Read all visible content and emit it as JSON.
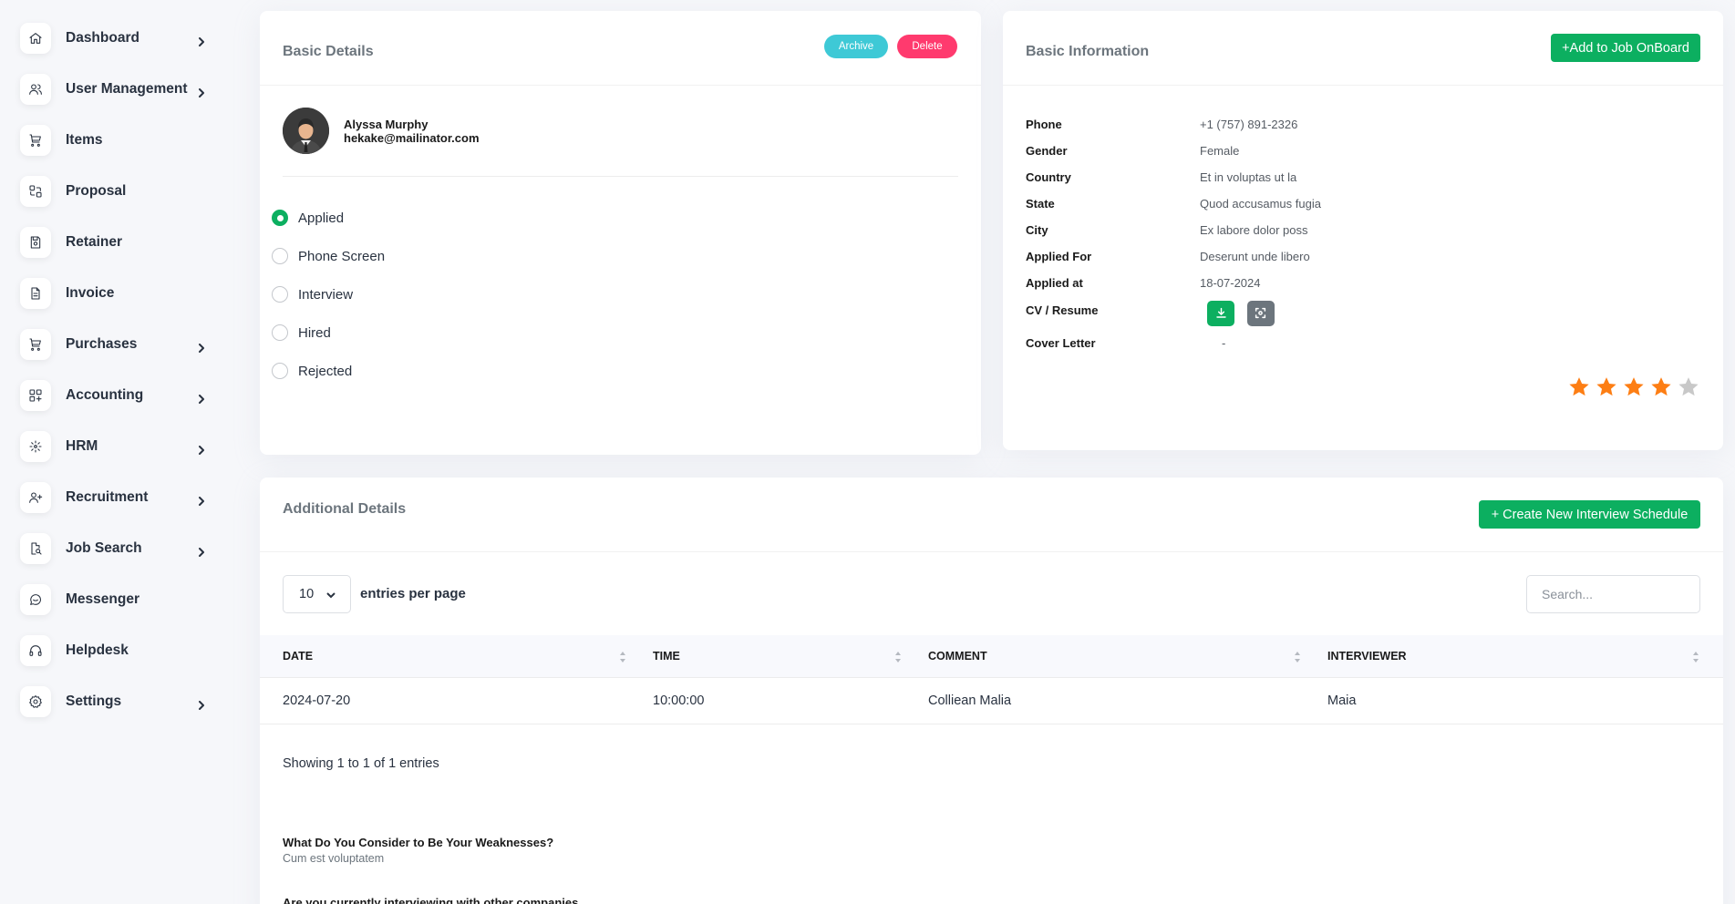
{
  "sidebar": {
    "items": [
      {
        "label": "Dashboard",
        "icon": "home-icon",
        "chevron": true
      },
      {
        "label": "User Management",
        "icon": "users-icon",
        "chevron": true
      },
      {
        "label": "Items",
        "icon": "cart-icon",
        "chevron": false
      },
      {
        "label": "Proposal",
        "icon": "exchange-icon",
        "chevron": false
      },
      {
        "label": "Retainer",
        "icon": "save-icon",
        "chevron": false
      },
      {
        "label": "Invoice",
        "icon": "file-invoice-icon",
        "chevron": false
      },
      {
        "label": "Purchases",
        "icon": "shopping-cart-icon",
        "chevron": true
      },
      {
        "label": "Accounting",
        "icon": "layout-grid-icon",
        "chevron": true
      },
      {
        "label": "HRM",
        "icon": "hrm-icon",
        "chevron": true
      },
      {
        "label": "Recruitment",
        "icon": "user-plus-icon",
        "chevron": true
      },
      {
        "label": "Job Search",
        "icon": "file-search-icon",
        "chevron": true
      },
      {
        "label": "Messenger",
        "icon": "message-icon",
        "chevron": false
      },
      {
        "label": "Helpdesk",
        "icon": "headphones-icon",
        "chevron": false
      },
      {
        "label": "Settings",
        "icon": "gear-icon",
        "chevron": true
      }
    ]
  },
  "basic_details": {
    "title": "Basic Details",
    "archive_label": "Archive",
    "delete_label": "Delete",
    "name": "Alyssa Murphy",
    "email": "hekake@mailinator.com",
    "statuses": [
      {
        "label": "Applied",
        "checked": true
      },
      {
        "label": "Phone Screen",
        "checked": false
      },
      {
        "label": "Interview",
        "checked": false
      },
      {
        "label": "Hired",
        "checked": false
      },
      {
        "label": "Rejected",
        "checked": false
      }
    ]
  },
  "basic_information": {
    "title": "Basic Information",
    "add_onboard_label": "+Add to Job OnBoard",
    "rows": {
      "phone": {
        "key": "Phone",
        "value": "+1 (757) 891-2326"
      },
      "gender": {
        "key": "Gender",
        "value": "Female"
      },
      "country": {
        "key": "Country",
        "value": "Et in voluptas ut la"
      },
      "state": {
        "key": "State",
        "value": "Quod accusamus fugia"
      },
      "city": {
        "key": "City",
        "value": "Ex labore dolor poss"
      },
      "applied_for": {
        "key": "Applied For",
        "value": "Deserunt unde libero"
      },
      "applied_at": {
        "key": "Applied at",
        "value": "18-07-2024"
      },
      "cv": {
        "key": "CV / Resume"
      },
      "cover_letter": {
        "key": "Cover Letter",
        "value": "-"
      }
    },
    "rating": {
      "value": 4,
      "max": 5
    },
    "colors": {
      "star_on": "#fd7e14",
      "star_off": "#c8c8c8",
      "green": "#0caf60",
      "gray": "#6c757d"
    }
  },
  "additional_details": {
    "title": "Additional Details",
    "create_schedule_label": "+ Create New Interview Schedule",
    "per_page_value": "10",
    "entries_label": "entries per page",
    "search_placeholder": "Search...",
    "columns": [
      "DATE",
      "TIME",
      "COMMENT",
      "INTERVIEWER"
    ],
    "rows": [
      {
        "date": "2024-07-20",
        "time": "10:00:00",
        "comment": "Colliean Malia",
        "interviewer": "Maia"
      }
    ],
    "showing": "Showing 1 to 1 of 1 entries",
    "questions": [
      {
        "q": "What Do You Consider to Be Your Weaknesses?",
        "a": "Cum est voluptatem"
      },
      {
        "q": "Are you currently interviewing with other companies",
        "a": ""
      }
    ]
  }
}
